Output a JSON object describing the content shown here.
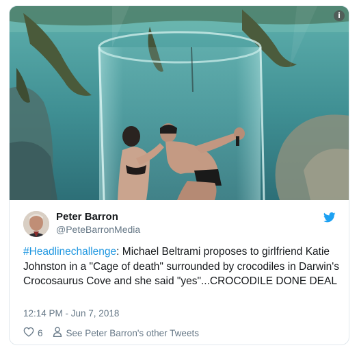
{
  "tweet": {
    "author": {
      "display_name": "Peter Barron",
      "handle": "@PeteBarronMedia"
    },
    "text": {
      "hashtag": "#Headlinechallenge",
      "body": ": Michael Beltrami proposes to girlfriend Katie Johnston in a \"Cage of death\" surrounded by crocodiles in Darwin's Crocosaurus Cove and she said \"yes\"...CROCODILE DONE DEAL"
    },
    "timestamp": "12:14 PM - Jun 7, 2018",
    "likes": "6",
    "other_tweets_label": "See Peter Barron's other Tweets",
    "info_icon": "i"
  },
  "colors": {
    "link": "#1b95e0",
    "secondary_text": "#657786",
    "twitter_blue": "#1da1f2",
    "border": "#e1e8ed"
  },
  "icons": [
    "info-icon",
    "twitter-bird-icon",
    "heart-icon",
    "person-icon"
  ]
}
